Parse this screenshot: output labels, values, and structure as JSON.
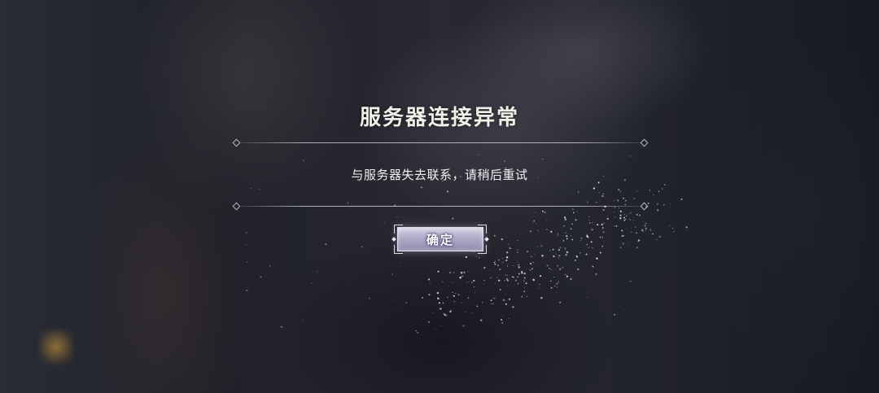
{
  "dialog": {
    "title": "服务器连接异常",
    "message": "与服务器失去联系，请稍后重试",
    "confirm_label": "确定"
  },
  "colors": {
    "accent": "#b3aec9",
    "text": "#f2efe8"
  },
  "icons": {
    "divider_ornament": "diamond-icon"
  }
}
